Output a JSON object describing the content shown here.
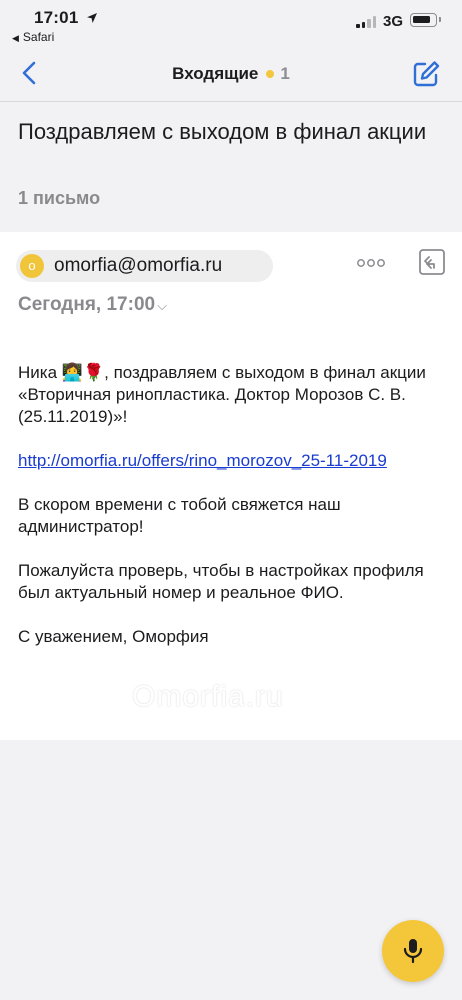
{
  "status_bar": {
    "time": "17:01",
    "back_app": "Safari",
    "network": "3G"
  },
  "nav": {
    "title": "Входящие",
    "unread_count": "1",
    "accent": "#2f6fd6",
    "dot_color": "#f2c73b"
  },
  "thread": {
    "subject": "Поздравляем с выходом в финал акции",
    "count_label": "1 письмо"
  },
  "message": {
    "sender_initial": "o",
    "sender_email": "omorfia@omorfia.ru",
    "date": "Сегодня, 17:00",
    "body": {
      "greeting_name": "Ника",
      "emoji": "👩‍💻🌹",
      "greeting_text": ", поздравляем с выходом в финал акции «Вторичная ринопластика. Доктор Морозов С. В. (25.11.2019)»!",
      "link": "http://omorfia.ru/offers/rino_morozov_25-11-2019",
      "paragraph2": "В скором времени с тобой свяжется наш администратор!",
      "paragraph3": "Пожалуйста проверь, чтобы в настройках профиля был актуальный номер и реальное ФИО.",
      "signature": "С уважением, Оморфия"
    },
    "watermark": "Omorfia.ru"
  },
  "icons": {
    "back": "chevron-left-icon",
    "compose": "compose-icon",
    "more": "more-icon",
    "reply": "reply-icon",
    "mic": "microphone-icon"
  }
}
